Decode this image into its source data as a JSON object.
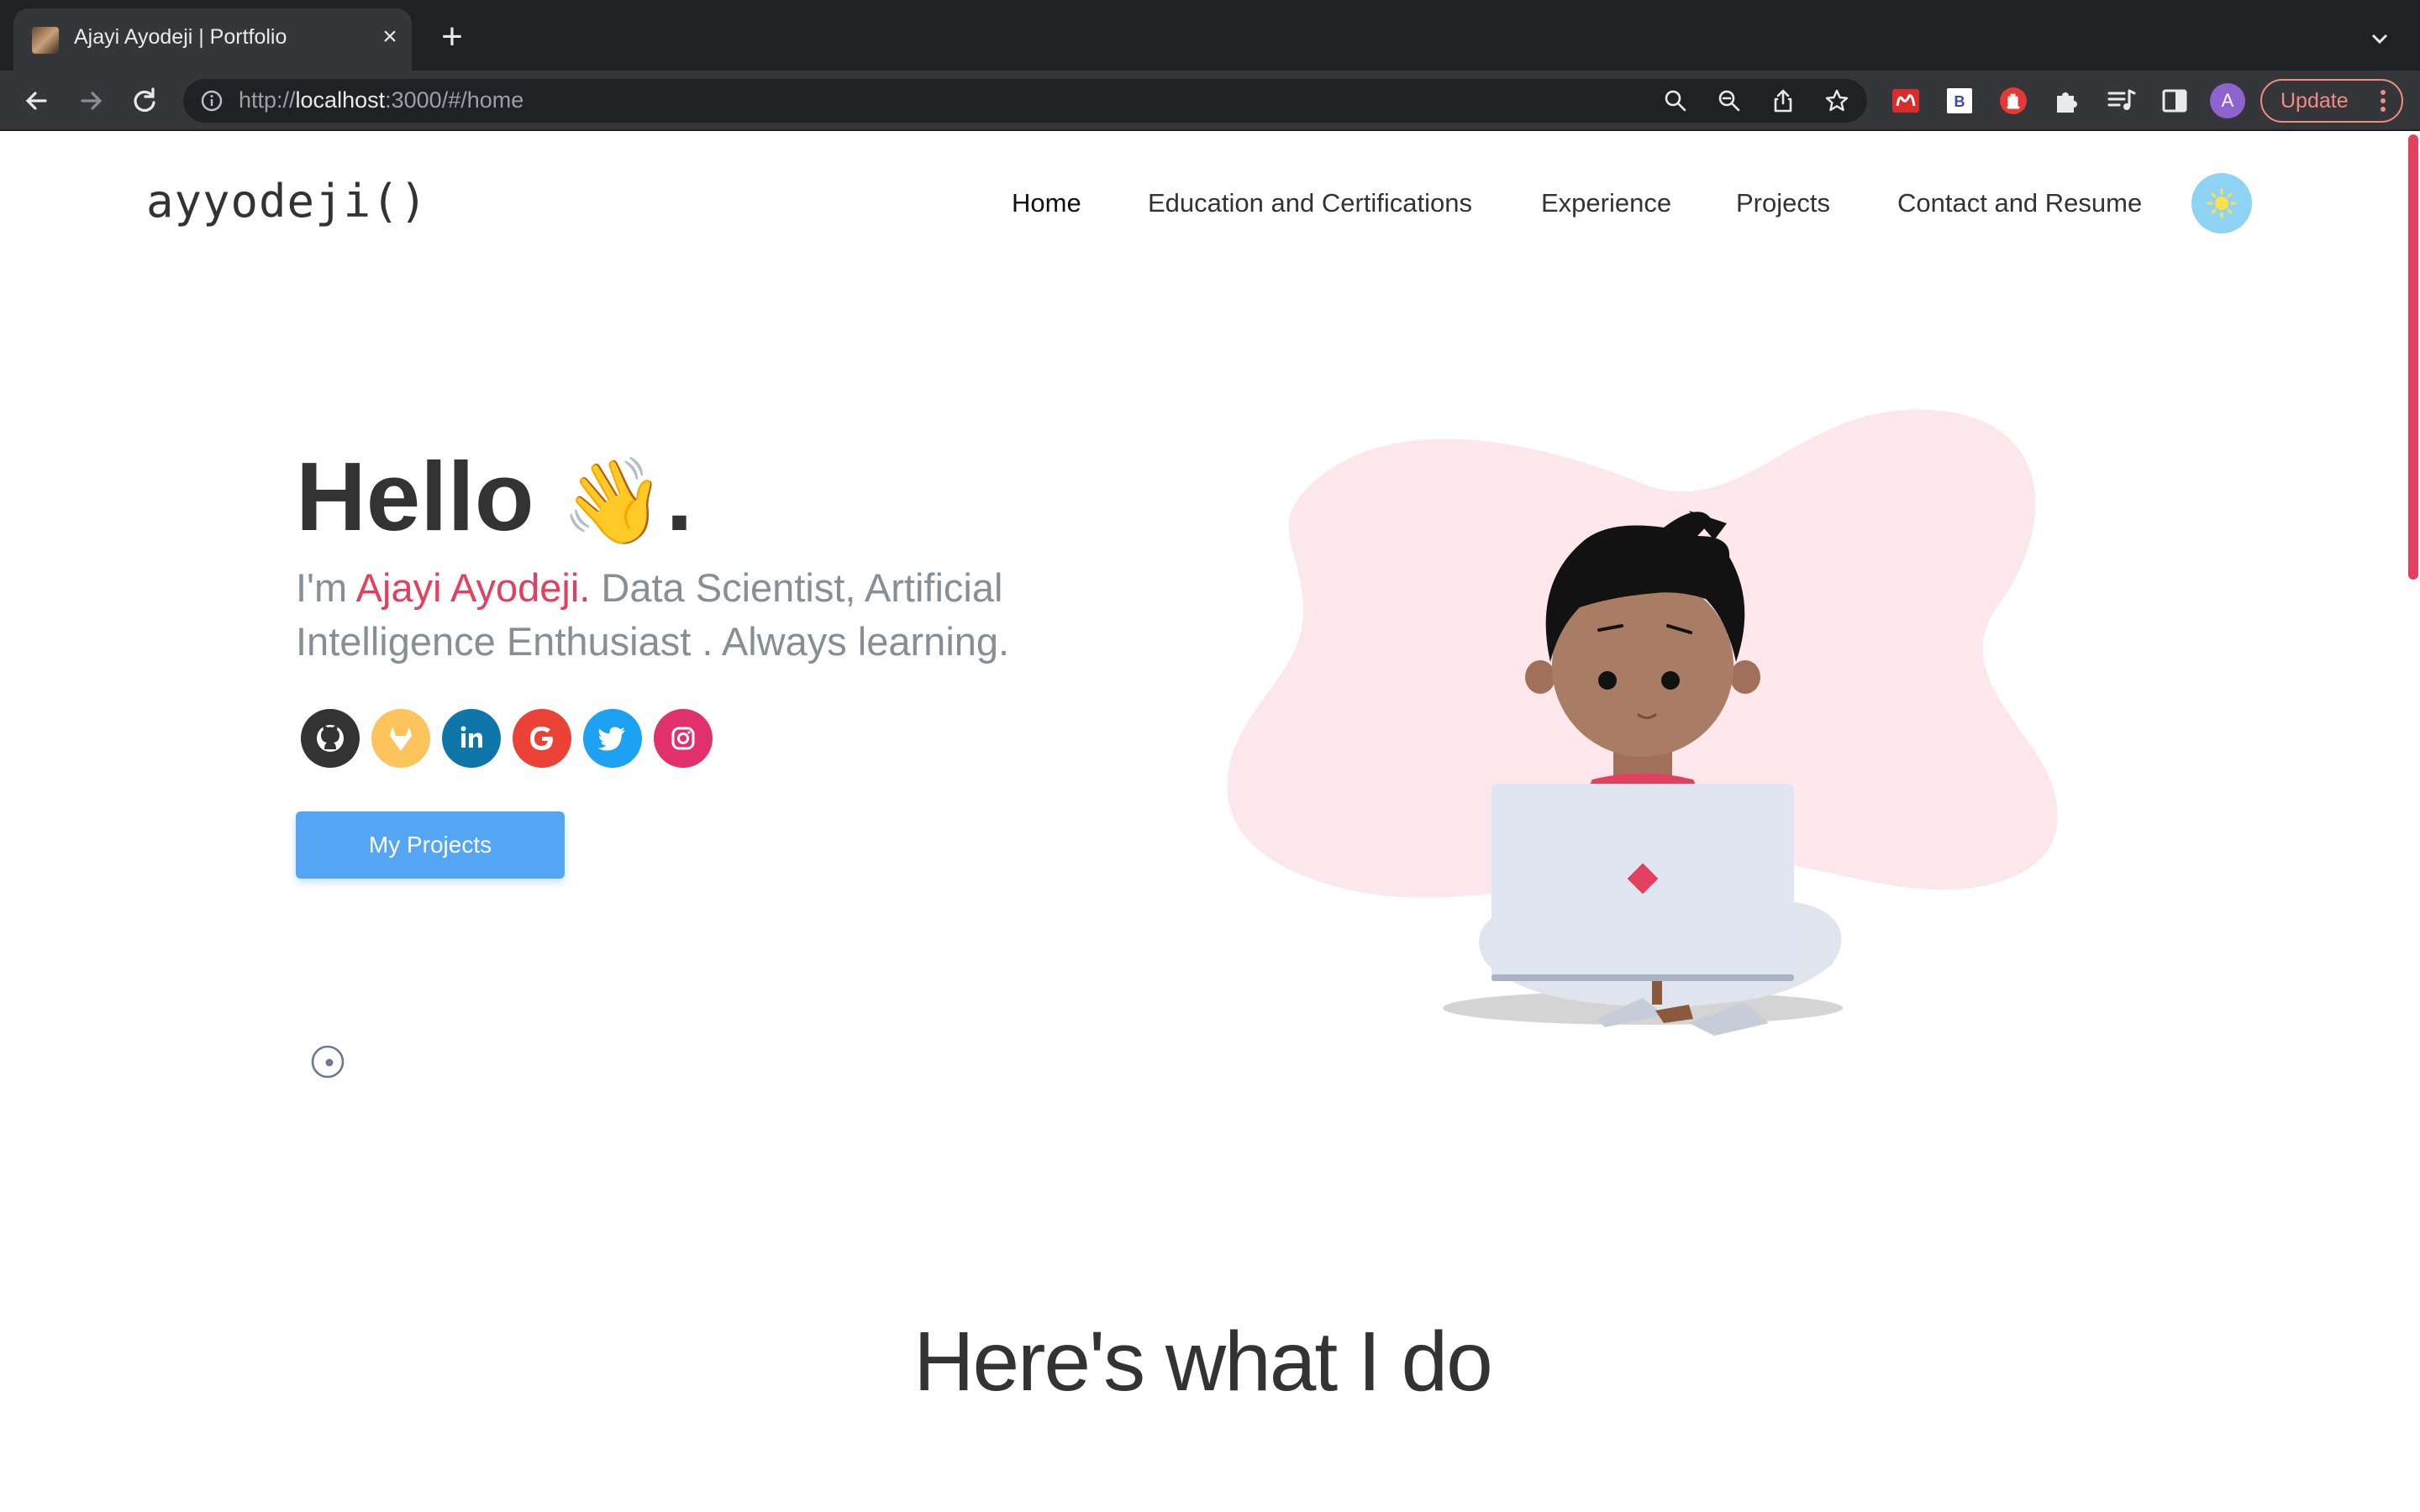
{
  "browser": {
    "tab_title": "Ajayi Ayodeji | Portfolio",
    "url_scheme": "http://",
    "url_host": "localhost",
    "url_rest": ":3000/#/home",
    "profile_initial": "A",
    "update_label": "Update"
  },
  "header": {
    "logo": "ayyodeji()",
    "nav": [
      "Home",
      "Education and Certifications",
      "Experience",
      "Projects",
      "Contact and Resume"
    ],
    "active_nav": "Home",
    "theme_icon": "sun-icon"
  },
  "hero": {
    "greeting": "Hello",
    "greeting_emoji": "👋",
    "greeting_end": ".",
    "intro_prefix": "I'm ",
    "intro_name": "Ajayi Ayodeji.",
    "intro_rest": " Data Scientist, Artificial Intelligence Enthusiast . Always learning.",
    "socials": [
      {
        "name": "github",
        "color": "#333333"
      },
      {
        "name": "gitlab",
        "color": "#fcc45a"
      },
      {
        "name": "linkedin",
        "color": "#0e76a8"
      },
      {
        "name": "google",
        "color": "#ea4335"
      },
      {
        "name": "twitter",
        "color": "#1da1f2"
      },
      {
        "name": "instagram",
        "color": "#e1306c"
      }
    ],
    "cta_label": "My Projects"
  },
  "section": {
    "title": "Here's what I do"
  },
  "colors": {
    "accent": "#e3405f",
    "button": "#55a5f5",
    "text": "#333333",
    "muted": "#868e96"
  }
}
